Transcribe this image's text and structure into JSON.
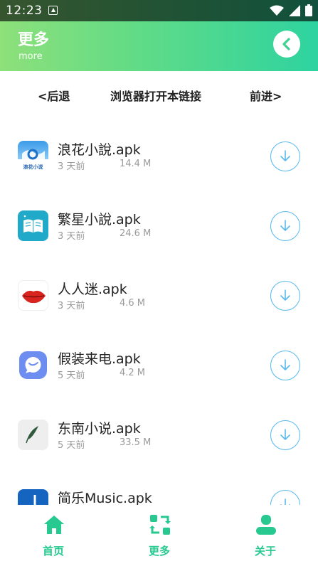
{
  "status_bar": {
    "time": "12:23"
  },
  "header": {
    "title": "更多",
    "subtitle": "more"
  },
  "browser_nav": {
    "back": "<后退",
    "open": "浏览器打开本链接",
    "forward": "前进>"
  },
  "apps": [
    {
      "name": "浪花小說.apk",
      "age": "3 天前",
      "size": "14.4 M",
      "icon": "langhua-app-icon",
      "icon_text": "浪花小说"
    },
    {
      "name": "繁星小說.apk",
      "age": "3 天前",
      "size": "24.6 M",
      "icon": "fanxing-book-icon"
    },
    {
      "name": "人人迷.apk",
      "age": "3 天前",
      "size": "4.6 M",
      "icon": "lips-icon"
    },
    {
      "name": "假装来电.apk",
      "age": "5 天前",
      "size": "4.2 M",
      "icon": "chat-bubble-icon"
    },
    {
      "name": "东南小说.apk",
      "age": "5 天前",
      "size": "33.5 M",
      "icon": "feather-icon"
    },
    {
      "name": "简乐Music.apk",
      "age": "",
      "size": "",
      "icon": "music-note-icon"
    }
  ],
  "tabs": [
    {
      "label": "首页",
      "icon": "home-icon"
    },
    {
      "label": "更多",
      "icon": "refresh-icon"
    },
    {
      "label": "关于",
      "icon": "user-icon"
    }
  ],
  "colors": {
    "accent": "#28c990",
    "download_ring": "#5ab9ef",
    "header_start": "#8ee07a",
    "header_end": "#2ed3a0"
  }
}
